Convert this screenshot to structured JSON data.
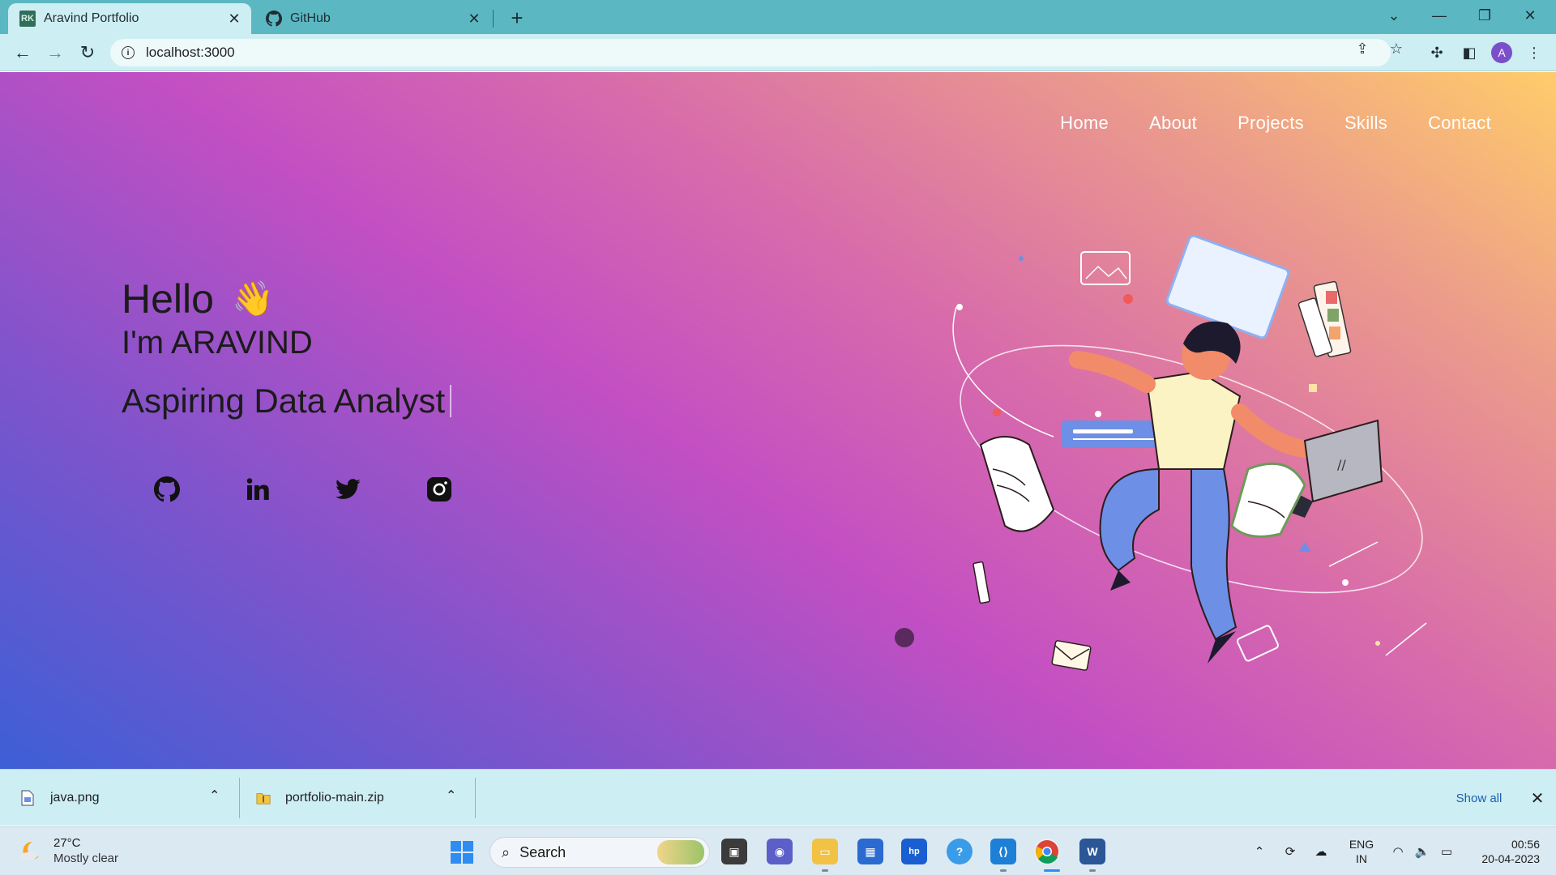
{
  "browser": {
    "tabs": [
      {
        "title": "Aravind Portfolio",
        "favicon_text": "RK",
        "active": true
      },
      {
        "title": "GitHub",
        "active": false
      }
    ],
    "new_tab_label": "+",
    "url": "localhost:3000"
  },
  "page": {
    "nav": [
      "Home",
      "About",
      "Projects",
      "Skills",
      "Contact"
    ],
    "hero": {
      "greeting": "Hello",
      "wave_emoji": "👋",
      "intro": "I'm ARAVIND",
      "role": "Aspiring Data Analyst"
    },
    "socials": [
      "github-icon",
      "linkedin-icon",
      "twitter-icon",
      "instagram-icon"
    ],
    "colors": {
      "gradient_start": "#3d5fd6",
      "gradient_mid": "#c34fc3",
      "gradient_end": "#ffcc6a",
      "nav_text": "#ffffff",
      "hero_text": "#1b1b1b"
    }
  },
  "downloads": {
    "items": [
      {
        "name": "java.png"
      },
      {
        "name": "portfolio-main.zip"
      }
    ],
    "show_all": "Show all"
  },
  "taskbar": {
    "weather": {
      "temp": "27°C",
      "condition": "Mostly clear"
    },
    "search_placeholder": "Search",
    "language": {
      "line1": "ENG",
      "line2": "IN"
    },
    "clock": {
      "time": "00:56",
      "date": "20-04-2023"
    }
  }
}
